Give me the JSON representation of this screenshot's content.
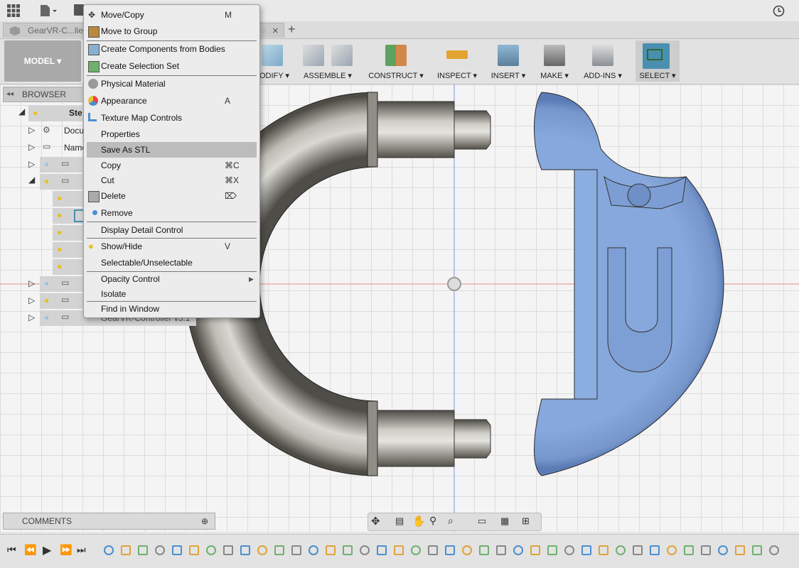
{
  "app": {
    "document_tab": "GearVR-C...ller",
    "new_tab_symbol": "+",
    "close_symbol": "×"
  },
  "toolbar": {
    "workspace": "MODEL ▾",
    "groups": [
      {
        "label": "ODIFY ▾",
        "icon": "modify-icon"
      },
      {
        "label": "ASSEMBLE ▾",
        "icon": "assemble-icon"
      },
      {
        "label": "CONSTRUCT ▾",
        "icon": "construct-icon"
      },
      {
        "label": "INSPECT ▾",
        "icon": "inspect-icon"
      },
      {
        "label": "INSERT ▾",
        "icon": "insert-icon"
      },
      {
        "label": "MAKE ▾",
        "icon": "make-icon"
      },
      {
        "label": "ADD-INS ▾",
        "icon": "add-ins-icon"
      },
      {
        "label": "SELECT ▾",
        "icon": "select-icon"
      }
    ]
  },
  "browser": {
    "title": "BROWSER",
    "collapse_symbol": "◂◂",
    "rows": [
      {
        "label": "Ste"
      },
      {
        "label": "Docu"
      },
      {
        "label": "Name"
      },
      {
        "label": ""
      },
      {
        "label": ""
      },
      {
        "label": "GearVR-Controller v3:1"
      }
    ]
  },
  "comments": {
    "title": "COMMENTS"
  },
  "context_menu": {
    "items": [
      {
        "label": "Move/Copy",
        "shortcut": "M",
        "icon": "move-icon"
      },
      {
        "label": "Move to Group",
        "shortcut": "",
        "icon": "group-icon"
      },
      {
        "label": "Create Components from Bodies",
        "shortcut": "",
        "icon": "components-icon"
      },
      {
        "label": "Create Selection Set",
        "shortcut": "",
        "icon": "selection-set-icon"
      },
      {
        "label": "Physical Material",
        "shortcut": "",
        "icon": "material-icon"
      },
      {
        "label": "Appearance",
        "shortcut": "A",
        "icon": "appearance-icon"
      },
      {
        "label": "Texture Map Controls",
        "shortcut": "",
        "icon": "texture-icon"
      },
      {
        "label": "Properties",
        "shortcut": "",
        "icon": ""
      },
      {
        "label": "Save As STL",
        "shortcut": "",
        "icon": ""
      },
      {
        "label": "Copy",
        "shortcut": "⌘C",
        "icon": ""
      },
      {
        "label": "Cut",
        "shortcut": "⌘X",
        "icon": ""
      },
      {
        "label": "Delete",
        "shortcut": "⌦",
        "icon": "delete-icon"
      },
      {
        "label": "Remove",
        "shortcut": "",
        "icon": "remove-icon"
      },
      {
        "label": "Display Detail Control",
        "shortcut": "",
        "icon": ""
      },
      {
        "label": "Show/Hide",
        "shortcut": "V",
        "icon": "bulb-icon"
      },
      {
        "label": "Selectable/Unselectable",
        "shortcut": "",
        "icon": ""
      },
      {
        "label": "Opacity Control",
        "shortcut": "▶",
        "icon": ""
      },
      {
        "label": "Isolate",
        "shortcut": "",
        "icon": ""
      },
      {
        "label": "Find in Window",
        "shortcut": "",
        "icon": ""
      }
    ]
  },
  "colors": {
    "accent_select": "#4a8fb0",
    "selected_body": "#7fa3d9",
    "steel_body": "#7d7b74",
    "menu_highlight": "#bcbcbc"
  }
}
